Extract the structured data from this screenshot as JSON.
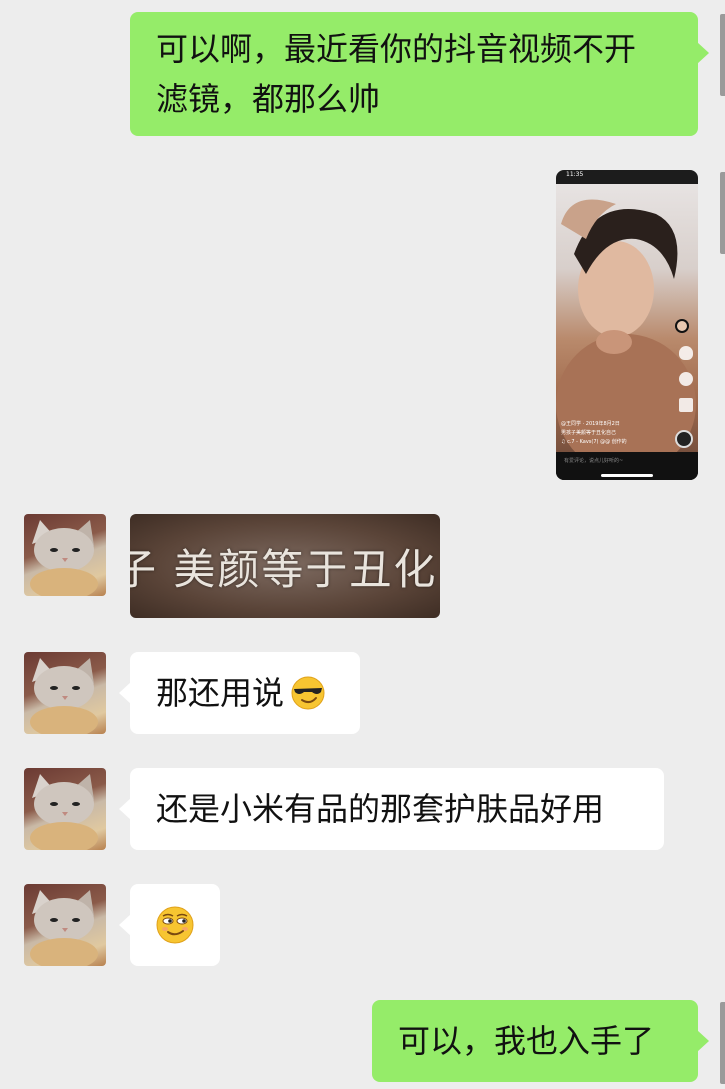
{
  "messages": [
    {
      "id": "m1",
      "side": "out",
      "type": "text",
      "lines": [
        "可以啊，最近看你的抖音视频不开",
        "滤镜，都那么帅"
      ]
    },
    {
      "id": "m2",
      "side": "out",
      "type": "image",
      "image": {
        "status_time": "11:35",
        "caption_user": "@王同学 · 2019年8月2日",
        "caption_text": "男孩子美颜等于丑化自己",
        "music": "♫ c.7 - Kavs(7)  @@ 创作的",
        "comment_placeholder": "有爱评论，说点儿好听的~"
      }
    },
    {
      "id": "m3",
      "side": "in",
      "type": "sticker",
      "text": "子 美颜等于丑化自"
    },
    {
      "id": "m4",
      "side": "in",
      "type": "text",
      "text": "那还用说",
      "emoji": "cool-sunglasses-emoji"
    },
    {
      "id": "m5",
      "side": "in",
      "type": "text",
      "text": "还是小米有品的那套护肤品好用"
    },
    {
      "id": "m6",
      "side": "in",
      "type": "emoji",
      "emoji": "smirk-emoji"
    },
    {
      "id": "m7",
      "side": "out",
      "type": "text",
      "text": "可以，我也入手了"
    }
  ],
  "colors": {
    "background": "#ededed",
    "outgoing_bubble": "#95ec69",
    "incoming_bubble": "#ffffff",
    "text": "#111111"
  }
}
